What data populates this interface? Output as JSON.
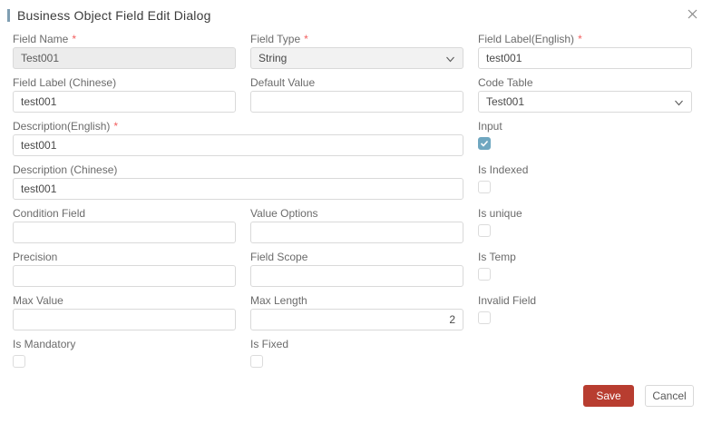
{
  "ui": {
    "required_marker": "*"
  },
  "dialog": {
    "title": "Business Object Field Edit Dialog"
  },
  "colors": {
    "accent_bar": "#7f9eb2",
    "required_asterisk": "#f25e5e",
    "checkbox_checked": "#6fa7c0",
    "save_button": "#b83d30"
  },
  "fields": {
    "field_name": {
      "label": "Field Name",
      "required": true,
      "value": "Test001",
      "disabled": true
    },
    "field_type": {
      "label": "Field Type",
      "required": true,
      "value": "String",
      "control": "select"
    },
    "field_label_english": {
      "label": "Field Label(English)",
      "required": true,
      "value": "test001"
    },
    "field_label_chinese": {
      "label": "Field Label (Chinese)",
      "value": "test001"
    },
    "default_value": {
      "label": "Default Value",
      "value": ""
    },
    "code_table": {
      "label": "Code Table",
      "value": "Test001",
      "control": "select"
    },
    "description_english": {
      "label": "Description(English)",
      "required": true,
      "value": "test001"
    },
    "input": {
      "label": "Input",
      "control": "checkbox",
      "checked": true
    },
    "description_chinese": {
      "label": "Description (Chinese)",
      "value": "test001"
    },
    "is_indexed": {
      "label": "Is Indexed",
      "control": "checkbox",
      "checked": false
    },
    "condition_field": {
      "label": "Condition Field",
      "value": ""
    },
    "value_options": {
      "label": "Value Options",
      "value": ""
    },
    "is_unique": {
      "label": "Is unique",
      "control": "checkbox",
      "checked": false
    },
    "precision": {
      "label": "Precision",
      "value": ""
    },
    "field_scope": {
      "label": "Field Scope",
      "value": ""
    },
    "is_temp": {
      "label": "Is Temp",
      "control": "checkbox",
      "checked": false
    },
    "max_value": {
      "label": "Max Value",
      "value": ""
    },
    "max_length": {
      "label": "Max Length",
      "value": "2"
    },
    "invalid_field": {
      "label": "Invalid Field",
      "control": "checkbox",
      "checked": false
    },
    "is_mandatory": {
      "label": "Is Mandatory",
      "control": "checkbox",
      "checked": false
    },
    "is_fixed": {
      "label": "Is Fixed",
      "control": "checkbox",
      "checked": false
    }
  },
  "footer": {
    "save_label": "Save",
    "cancel_label": "Cancel"
  }
}
